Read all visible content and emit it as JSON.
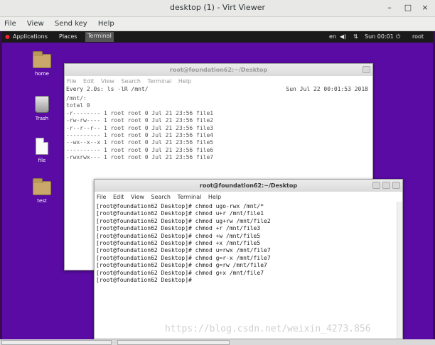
{
  "viewer": {
    "title": "desktop (1) - Virt Viewer",
    "menu": [
      "File",
      "View",
      "Send key",
      "Help"
    ],
    "controls": {
      "min": "–",
      "max": "□",
      "close": "×"
    }
  },
  "topbar": {
    "applications": "Applications",
    "places": "Places",
    "terminal": "Terminal",
    "lang": "en",
    "clock": "Sun 00:01",
    "user": "root"
  },
  "desktop_icons": [
    {
      "label": "home",
      "icon": "home-folder-icon"
    },
    {
      "label": "Trash",
      "icon": "trash-icon"
    },
    {
      "label": "file",
      "icon": "file-icon"
    },
    {
      "label": "test",
      "icon": "folder-icon"
    }
  ],
  "term_back": {
    "title": "root@foundation62:~/Desktop",
    "menu": [
      "File",
      "Edit",
      "View",
      "Search",
      "Terminal",
      "Help"
    ],
    "header_left": "Every 2.0s: ls -lR /mnt/",
    "header_right": "Sun Jul 22 00:01:53 2018",
    "lines": [
      "",
      "/mnt/:",
      "total 0",
      "-r-------- 1 root root 0 Jul 21 23:56 file1",
      "-rw-rw---- 1 root root 0 Jul 21 23:56 file2",
      "-r--r--r-- 1 root root 0 Jul 21 23:56 file3",
      "---------- 1 root root 0 Jul 21 23:56 file4",
      "--wx--x--x 1 root root 0 Jul 21 23:56 file5",
      "---------- 1 root root 0 Jul 21 23:56 file6",
      "-rwxrwx--- 1 root root 0 Jul 21 23:56 file7"
    ]
  },
  "term_front": {
    "title": "root@foundation62:~/Desktop",
    "menu": [
      "File",
      "Edit",
      "View",
      "Search",
      "Terminal",
      "Help"
    ],
    "lines": [
      "[root@foundation62 Desktop]# chmod ugo-rwx /mnt/*",
      "[root@foundation62 Desktop]# chmod u+r /mnt/file1",
      "[root@foundation62 Desktop]# chmod ug+rw /mnt/file2",
      "[root@foundation62 Desktop]# chmod +r /mnt/file3",
      "[root@foundation62 Desktop]# chmod +w /mnt/file5",
      "[root@foundation62 Desktop]# chmod +x /mnt/file5",
      "[root@foundation62 Desktop]# chmod u=rwx /mnt/file7",
      "[root@foundation62 Desktop]# chmod g=r-x /mnt/file7",
      "[root@foundation62 Desktop]# chmod g=rw /mnt/file7",
      "[root@foundation62 Desktop]# chmod g+x /mnt/file7",
      "[root@foundation62 Desktop]#"
    ]
  },
  "watermark": "https://blog.csdn.net/weixin_4273.856"
}
